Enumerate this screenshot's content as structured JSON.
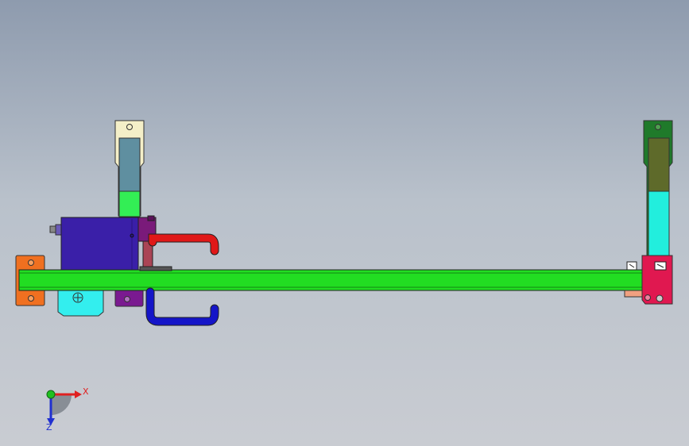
{
  "viewport": {
    "background_top": "#8e9bae",
    "background_bottom": "#c9ccd2"
  },
  "triad": {
    "x_label": "X",
    "z_label": "Z",
    "x_color": "#e02020",
    "y_color": "#20c020",
    "z_color": "#2030d0"
  },
  "parts": [
    {
      "name": "main-beam",
      "color": "#22dd22"
    },
    {
      "name": "left-upright-upper",
      "color": "#5f8fa0"
    },
    {
      "name": "left-upright-lower",
      "color": "#33ee55"
    },
    {
      "name": "left-upright-tab",
      "color": "#f4efc8"
    },
    {
      "name": "motor-housing",
      "color": "#3a1fa8"
    },
    {
      "name": "valve-block",
      "color": "#7a1a7a"
    },
    {
      "name": "red-hose",
      "color": "#e01818"
    },
    {
      "name": "blue-hose",
      "color": "#1515c8"
    },
    {
      "name": "orange-bracket",
      "color": "#f07020"
    },
    {
      "name": "cyan-bracket",
      "color": "#33eeee"
    },
    {
      "name": "purple-bracket",
      "color": "#7a1a90"
    },
    {
      "name": "right-upright-upper",
      "color": "#5e6a2a"
    },
    {
      "name": "right-upright-lower",
      "color": "#22eedd"
    },
    {
      "name": "right-upright-tab",
      "color": "#1f7a2a"
    },
    {
      "name": "right-bracket",
      "color": "#e01850"
    }
  ]
}
